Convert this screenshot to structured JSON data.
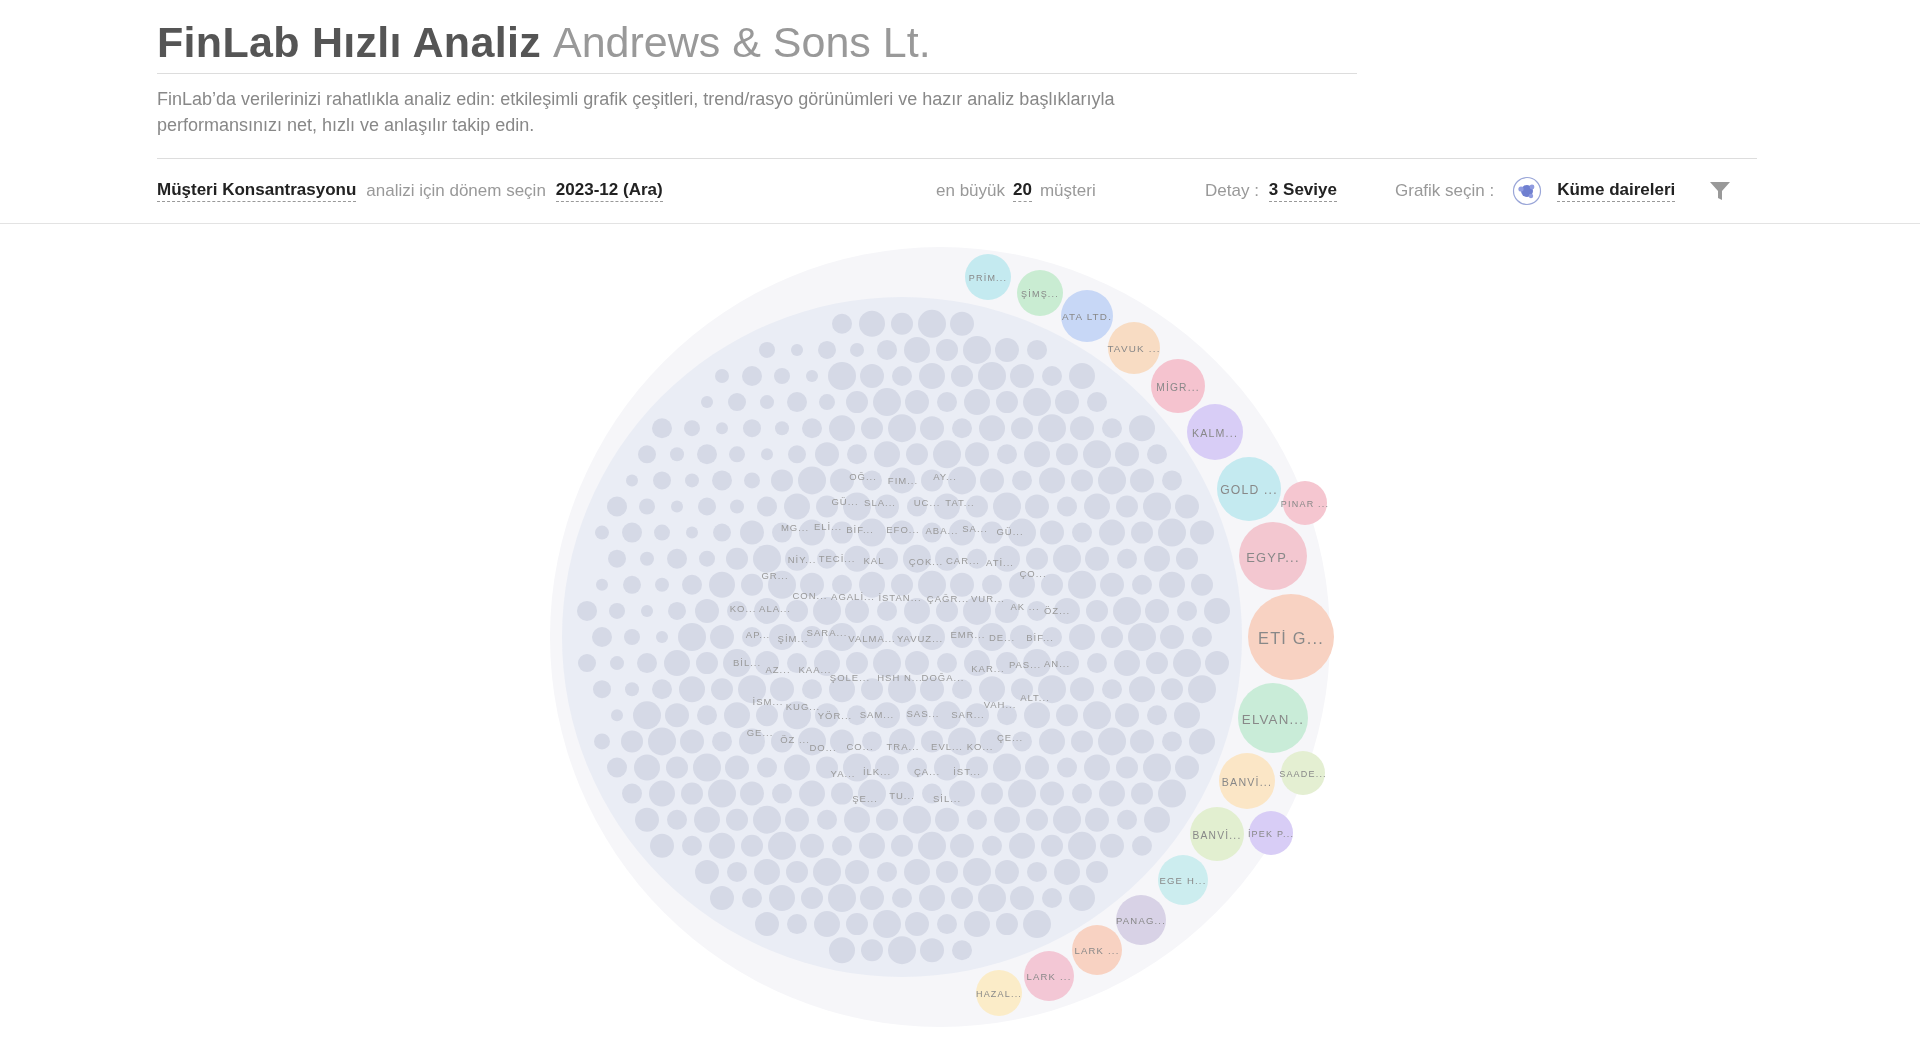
{
  "header": {
    "title": "FinLab Hızlı Analiz",
    "company": "Andrews & Sons Lt.",
    "description": "FinLab’da verilerinizi rahatlıkla analiz edin: etkileşimli grafik çeşitleri, trend/rasyo görünümleri ve hazır analiz başlıklarıyla performansınızı net, hızlı ve anlaşılır takip edin."
  },
  "toolbar": {
    "analysis": "Müşteri Konsantrasyonu",
    "analysis_text": "analizi için dönem seçin",
    "period": "2023-12 (Ara)",
    "top_prefix": "en büyük",
    "top_count": "20",
    "top_suffix": "müşteri",
    "detail_label": "Detay :",
    "detail": "3 Seviye",
    "chart_label": "Grafik seçin :",
    "chart_type": "Küme daireleri"
  },
  "outer_bubbles": [
    {
      "label": "PRİM...",
      "color": "#c4eaf0"
    },
    {
      "label": "ŞİMŞ...",
      "color": "#c9ecd2"
    },
    {
      "label": "ATA LTD.",
      "color": "#c7d7f6"
    },
    {
      "label": "TAVUK ...",
      "color": "#f8dcc3"
    },
    {
      "label": "MİGR...",
      "color": "#f5c3cf"
    },
    {
      "label": "KALM...",
      "color": "#d8cdf6"
    },
    {
      "label": "GOLD ...",
      "color": "#c4eaf0"
    },
    {
      "label": "PINAR ...",
      "color": "#f5c6d0"
    },
    {
      "label": "EGYP...",
      "color": "#f3c7d0"
    },
    {
      "label": "ETİ G...",
      "color": "#f8d2c2"
    },
    {
      "label": "ELVAN...",
      "color": "#c9ecd8"
    },
    {
      "label": "BANVİ...",
      "color": "#fbe6c6"
    },
    {
      "label": "SAADE...",
      "color": "#e4efd2"
    },
    {
      "label": "BANVİ...",
      "color": "#e2efd0"
    },
    {
      "label": "İPEK P...",
      "color": "#d8cdf6"
    },
    {
      "label": "EGE H...",
      "color": "#ccedef"
    },
    {
      "label": "PANAG...",
      "color": "#d8d2e6"
    },
    {
      "label": "LARK ...",
      "color": "#f8d2c2"
    },
    {
      "label": "LARK ...",
      "color": "#f3c7d5"
    },
    {
      "label": "HAZAL...",
      "color": "#fbecc8"
    }
  ],
  "inner_labels": [
    "OĞ...",
    "FIM...",
    "AY...",
    "GÜ...",
    "SLA...",
    "UC...",
    "TAT...",
    "MG...",
    "ELİ...",
    "BİF...",
    "EFO...",
    "ABA...",
    "SA...",
    "GÜ...",
    "NİY...",
    "TECİ...",
    "KAL",
    "ÇOK...",
    "CAR...",
    "ATİ...",
    "GR...",
    "ÇO...",
    "CON...",
    "AGALİ...",
    "İSTAN...",
    "ÇAĞR...",
    "VUR...",
    "KO...",
    "ALA...",
    "AK ...",
    "ÖZ...",
    "AP...",
    "ŞİM...",
    "SARA...",
    "VALMA...",
    "YAVUZ...",
    "EMR...",
    "DE...",
    "BİF...",
    "BİL...",
    "AZ...",
    "KAA...",
    "ŞOLE...",
    "HSH N...",
    "DOĞA...",
    "KAR...",
    "PAS...",
    "AN...",
    "İSM...",
    "KUG...",
    "YÖR...",
    "SAM...",
    "SAS...",
    "SAR...",
    "VAH...",
    "ALT...",
    "GE...",
    "ÖZ ...",
    "DO...",
    "CO...",
    "TRA...",
    "EVL...",
    "KO...",
    "ÇE...",
    "YA...",
    "İLK...",
    "ÇA...",
    "İST...",
    "ŞE...",
    "TU...",
    "SİL..."
  ]
}
